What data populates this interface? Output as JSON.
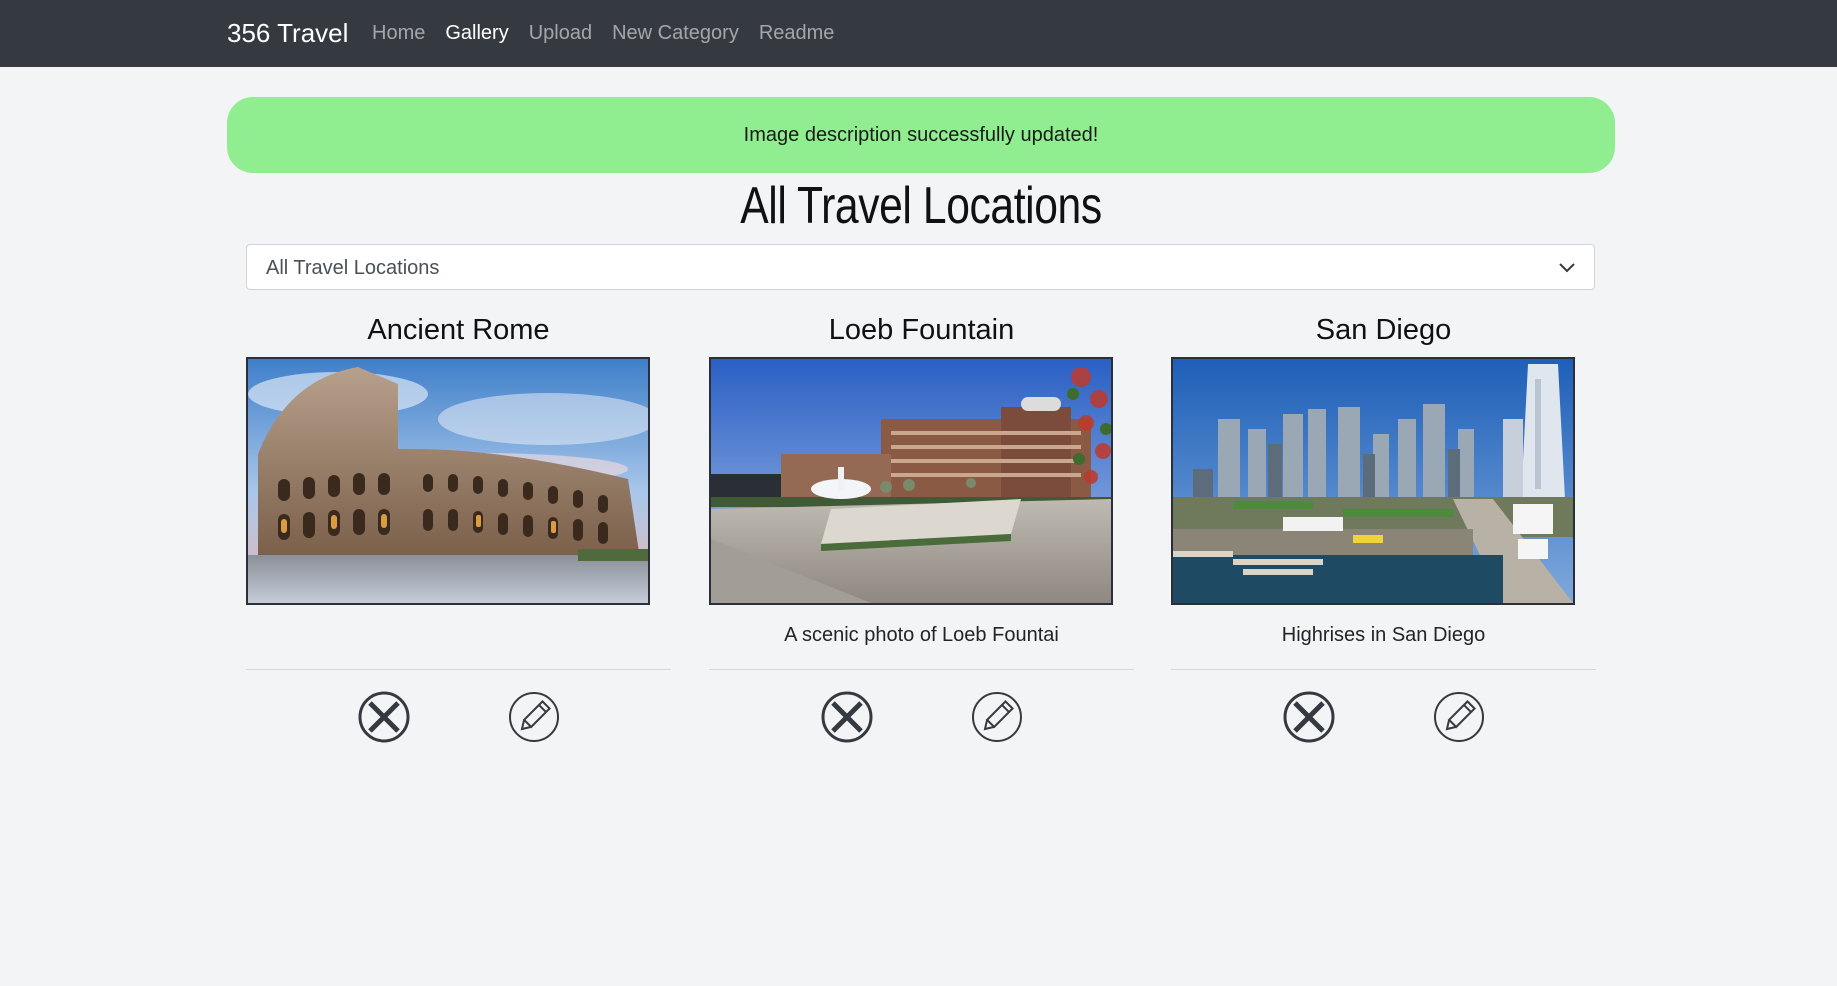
{
  "navbar": {
    "brand": "356 Travel",
    "links": [
      {
        "label": "Home",
        "active": false
      },
      {
        "label": "Gallery",
        "active": true
      },
      {
        "label": "Upload",
        "active": false
      },
      {
        "label": "New Category",
        "active": false
      },
      {
        "label": "Readme",
        "active": false
      }
    ]
  },
  "alert": {
    "message": "Image description successfully updated!",
    "color": "#90ee90"
  },
  "page": {
    "title": "All Travel Locations"
  },
  "category_select": {
    "selected": "All Travel Locations"
  },
  "gallery": [
    {
      "title": "Ancient Rome",
      "description": "",
      "image": "colosseum photo"
    },
    {
      "title": "Loeb Fountain",
      "description": "A scenic photo of Loeb Fountai",
      "image": "fountain plaza photo"
    },
    {
      "title": "San Diego",
      "description": "Highrises in San Diego",
      "image": "city skyline photo"
    }
  ],
  "icons": {
    "delete": "circle-x-icon",
    "edit": "pencil-icon"
  },
  "colors": {
    "navbar_bg": "#343a40",
    "page_bg": "#f3f4f6",
    "alert_bg": "#90ee90"
  }
}
